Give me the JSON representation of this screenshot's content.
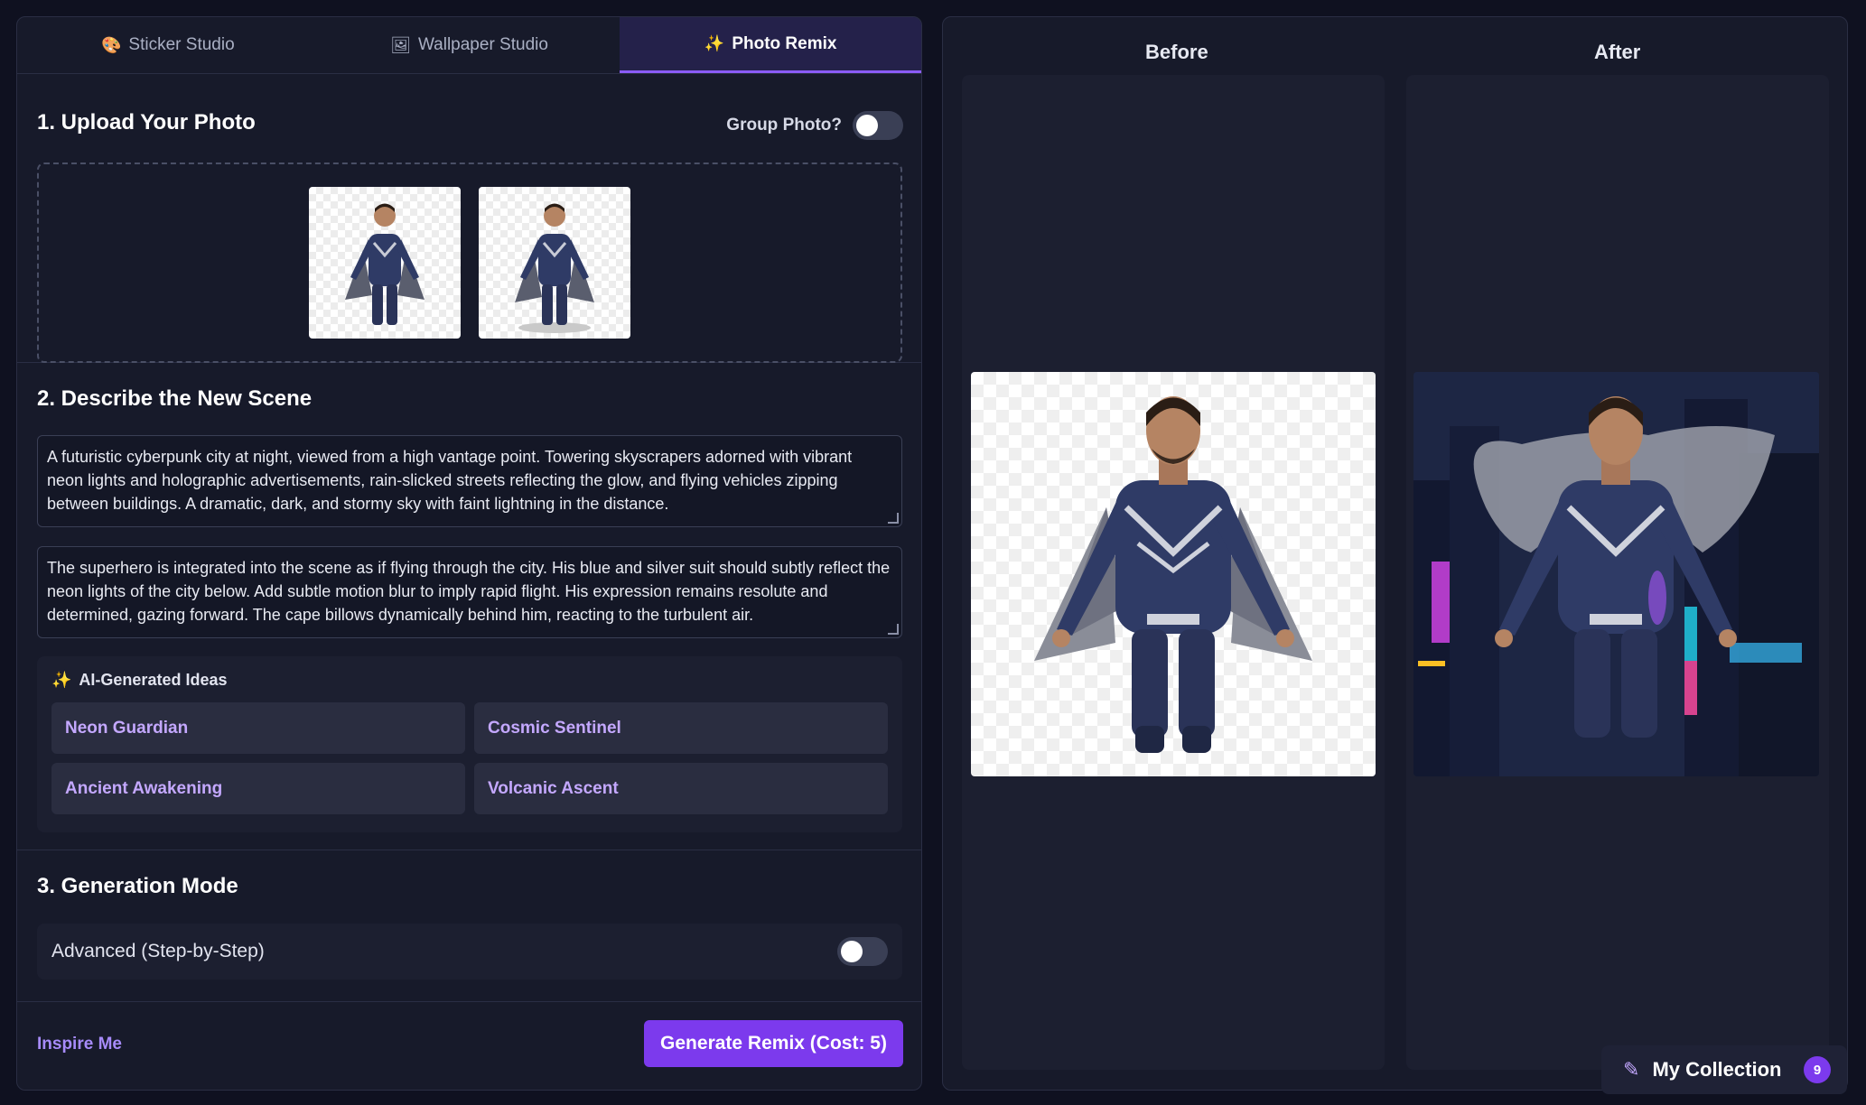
{
  "tabs": [
    {
      "label": "Sticker Studio",
      "icon": "palette-icon"
    },
    {
      "label": "Wallpaper Studio",
      "icon": "picture-icon"
    },
    {
      "label": "Photo Remix",
      "icon": "sparkles-icon",
      "active": true
    }
  ],
  "upload": {
    "title": "1. Upload Your Photo",
    "group_label": "Group Photo?",
    "group_enabled": false
  },
  "describe": {
    "title": "2. Describe the New Scene",
    "scene_text": "A futuristic cyberpunk city at night, viewed from a high vantage point. Towering skyscrapers adorned with vibrant neon lights and holographic advertisements, rain-slicked streets reflecting the glow, and flying vehicles zipping between buildings. A dramatic, dark, and stormy sky with faint lightning in the distance.",
    "subject_text": "The superhero is integrated into the scene as if flying through the city. His blue and silver suit should subtly reflect the neon lights of the city below. Add subtle motion blur to imply rapid flight. His expression remains resolute and determined, gazing forward. The cape billows dynamically behind him, reacting to the turbulent air.",
    "ideas_title": "AI-Generated Ideas",
    "ideas": [
      "Neon Guardian",
      "Cosmic Sentinel",
      "Ancient Awakening",
      "Volcanic Ascent"
    ]
  },
  "mode": {
    "title": "3. Generation Mode",
    "advanced_label": "Advanced (Step-by-Step)",
    "advanced_enabled": false
  },
  "footer": {
    "inspire_label": "Inspire Me",
    "generate_label": "Generate Remix (Cost: 5)"
  },
  "preview": {
    "before_label": "Before",
    "after_label": "After"
  },
  "collection": {
    "label": "My Collection",
    "count": "9"
  },
  "colors": {
    "accent": "#7c3aed",
    "link": "#a78bfa",
    "background": "#0f1120",
    "panel": "#171a2a"
  }
}
